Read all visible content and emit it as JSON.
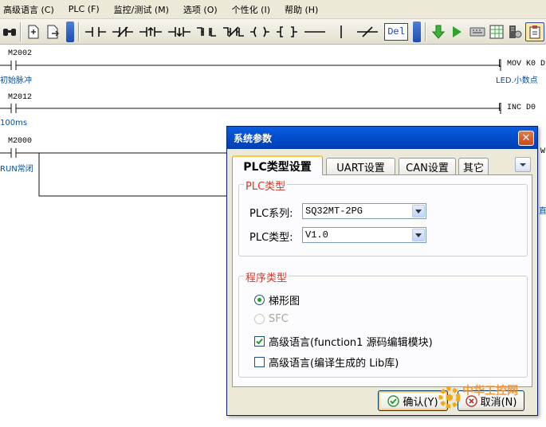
{
  "menu": [
    "高级语言 (C)",
    "PLC (F)",
    "监控/测试 (M)",
    "选项 (O)",
    "个性化 (I)",
    "帮助 (H)"
  ],
  "toolbar": {
    "delete_label": "Del"
  },
  "ladder": {
    "rungs": [
      {
        "contact": "M2002",
        "comment": "初始脉冲",
        "instruction": "[ MOV K0 D",
        "instruction_comment": "LED.小数点"
      },
      {
        "contact": "M2012",
        "comment": "100ms",
        "instruction": "[ INC D0"
      },
      {
        "contact": "M2000",
        "comment": "RUN常闭"
      }
    ],
    "edge_fragments": [
      "W",
      "直"
    ]
  },
  "dialog": {
    "title": "系统参数",
    "tabs": [
      "PLC类型设置",
      "UART设置",
      "CAN设置",
      "其它"
    ],
    "plc_group": {
      "title": "PLC类型",
      "series_label": "PLC系列:",
      "series_value": "SQ32MT-2PG",
      "type_label": "PLC类型:",
      "type_value": "V1.0"
    },
    "program_group": {
      "title": "程序类型",
      "options": [
        {
          "label": "梯形图",
          "kind": "radio",
          "checked": true,
          "enabled": true
        },
        {
          "label": "SFC",
          "kind": "radio",
          "checked": false,
          "enabled": false
        },
        {
          "label": "高级语言(function1 源码编辑模块)",
          "kind": "checkbox",
          "checked": true,
          "enabled": true
        },
        {
          "label": "高级语言(编译生成的 Lib库)",
          "kind": "checkbox",
          "checked": false,
          "enabled": true
        }
      ]
    },
    "ok_label": "确认(Y)",
    "cancel_label": "取消(N)"
  },
  "watermark": "中华工控网"
}
